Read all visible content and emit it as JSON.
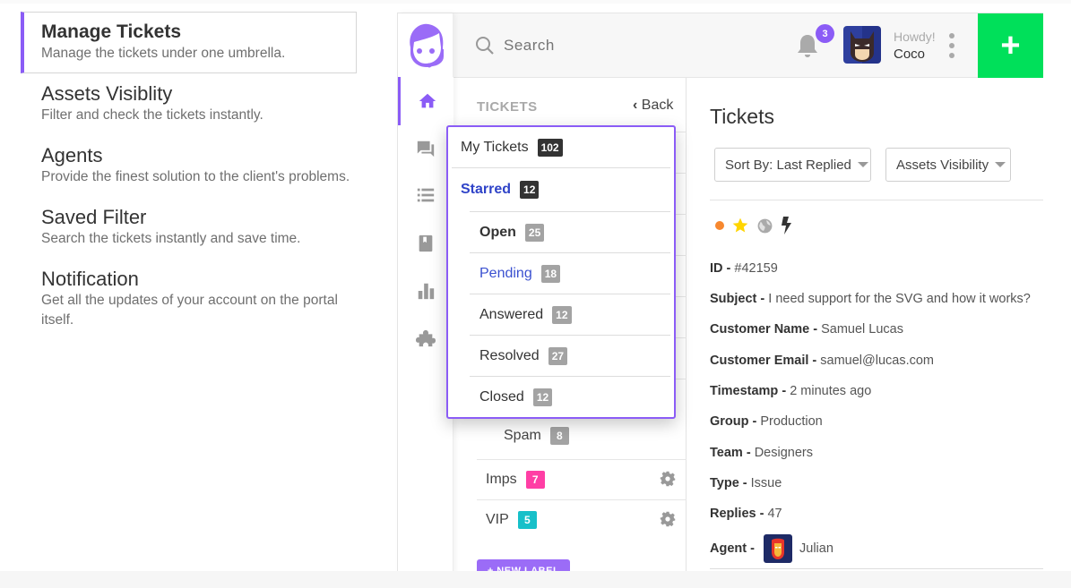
{
  "features": [
    {
      "title": "Manage Tickets",
      "desc": "Manage the tickets under one umbrella.",
      "active": true
    },
    {
      "title": "Assets Visiblity",
      "desc": "Filter and check the tickets instantly.",
      "active": false
    },
    {
      "title": "Agents",
      "desc": "Provide the finest solution to the client's problems.",
      "active": false
    },
    {
      "title": "Saved Filter",
      "desc": "Search the tickets instantly and save time.",
      "active": false
    },
    {
      "title": "Notification",
      "desc": "Get all the updates of your account on the portal itself.",
      "active": false
    }
  ],
  "rail": {
    "logo_icon": "support-agent-headset-icon",
    "items": [
      {
        "icon": "home-icon",
        "active": true
      },
      {
        "icon": "chat-icon",
        "active": false
      },
      {
        "icon": "list-icon",
        "active": false
      },
      {
        "icon": "bookmark-book-icon",
        "active": false
      },
      {
        "icon": "bar-chart-icon",
        "active": false
      },
      {
        "icon": "puzzle-icon",
        "active": false
      }
    ]
  },
  "topbar": {
    "search_placeholder": "Search",
    "notification_count": "3",
    "greeting": "Howdy!",
    "username": "Coco",
    "add_label": "+"
  },
  "tickets_panel": {
    "title": "TICKETS",
    "back_label": "Back",
    "spam": {
      "label": "Spam",
      "count": "8"
    },
    "labels": [
      {
        "label": "Imps",
        "count": "7",
        "color": "#ff3ea5"
      },
      {
        "label": "VIP",
        "count": "5",
        "color": "#17c0c9"
      }
    ],
    "new_label_button": "+ NEW LABEL"
  },
  "dropdown": {
    "my_tickets": {
      "label": "My Tickets",
      "count": "102"
    },
    "starred": {
      "label": "Starred",
      "count": "12"
    },
    "statuses": [
      {
        "label": "Open",
        "count": "25"
      },
      {
        "label": "Pending",
        "count": "18"
      },
      {
        "label": "Answered",
        "count": "12"
      },
      {
        "label": "Resolved",
        "count": "27"
      },
      {
        "label": "Closed",
        "count": "12"
      }
    ]
  },
  "details": {
    "title": "Tickets",
    "sort_select": "Sort By: Last Replied",
    "visibility_select": "Assets Visibility",
    "status_icons": [
      "orange-dot-icon",
      "star-icon",
      "globe-icon",
      "lightning-icon"
    ],
    "fields": [
      {
        "key": "ID - ",
        "value": "#42159"
      },
      {
        "key": "Subject - ",
        "value": "I need support for the SVG and how it works?"
      },
      {
        "key": "Customer Name - ",
        "value": "Samuel Lucas"
      },
      {
        "key": "Customer Email - ",
        "value": "samuel@lucas.com"
      },
      {
        "key": "Timestamp - ",
        "value": "2 minutes ago"
      },
      {
        "key": "Group - ",
        "value": "Production"
      },
      {
        "key": "Team - ",
        "value": "Designers"
      },
      {
        "key": "Type - ",
        "value": "Issue"
      },
      {
        "key": "Replies - ",
        "value": "47"
      }
    ],
    "agent": {
      "key": "Agent - ",
      "name": "Julian"
    }
  },
  "colors": {
    "accent": "#8b5cf6",
    "add_button": "#00e05a",
    "starred_text": "#2f43c8",
    "pending_text": "#3a50d0"
  }
}
